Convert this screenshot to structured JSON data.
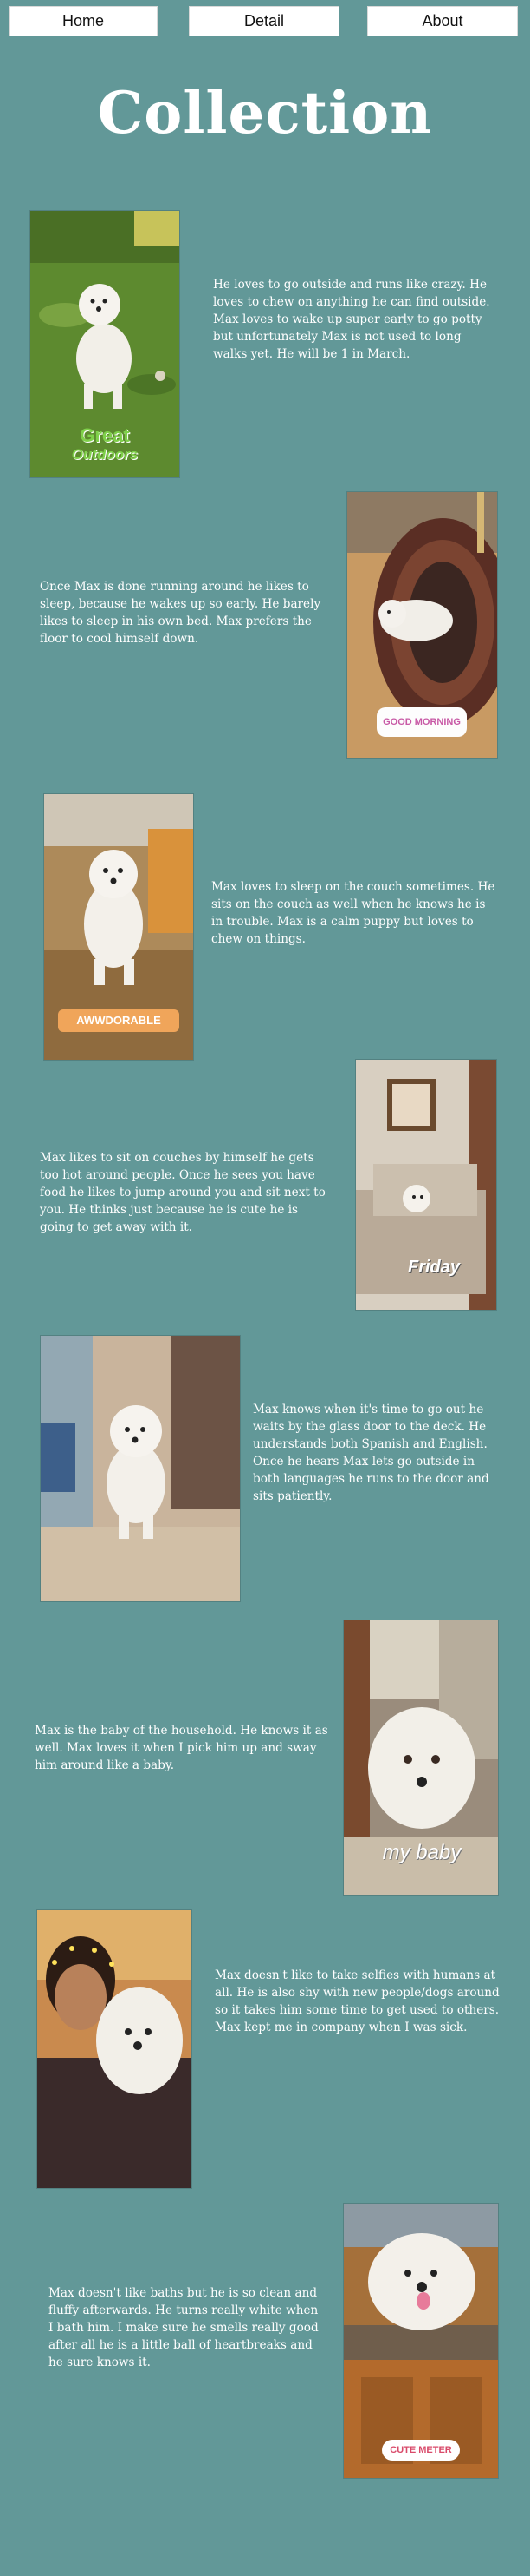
{
  "nav": {
    "home": "Home",
    "detail": "Detail",
    "about": "About"
  },
  "page_title": "Collection",
  "entries": [
    {
      "caption": "He loves to go outside and runs like crazy. He loves to chew on anything he can find outside. Max loves to wake up super early to go potty but unfortunately Max is not used to long walks yet. He will be 1 in March.",
      "sticker_line1": "Great",
      "sticker_line2": "Outdoors"
    },
    {
      "caption": "Once Max is done running around he likes to sleep, because he wakes up so early. He barely likes to sleep in his own bed. Max prefers the floor to cool himself down.",
      "sticker_line1": "GOOD MORNING"
    },
    {
      "caption": "Max loves to sleep on the couch sometimes. He sits on the couch as well when he knows he is in trouble. Max is a calm puppy but loves to chew on things.",
      "sticker_line1": "AWWDORABLE"
    },
    {
      "caption": "Max likes to sit on couches  by himself he gets too hot around people. Once he sees you have food he likes to jump around you and sit next to you. He thinks just because he is cute he is going to get away with it.",
      "sticker_line1": "Friday"
    },
    {
      "caption": "Max knows when it's time to go out he waits by the glass door to the deck. He understands both Spanish and English. Once he hears Max lets go outside in both languages he runs to the door and sits patiently."
    },
    {
      "caption": "Max is the baby of the household. He knows it as well. Max loves it when I pick him up and sway him around like a baby.",
      "sticker_line1": "my baby"
    },
    {
      "caption": "Max doesn't like to take selfies with humans at all. He is also shy with new people/dogs around so it takes him some time to get used to others. Max kept me in company when I was sick."
    },
    {
      "caption": "Max doesn't like baths but he is so clean and fluffy afterwards. He turns really white when I bath him. I make sure he smells really good after all he is a little ball of heartbreaks and he sure knows it.",
      "sticker_line1": "CUTE METER"
    }
  ],
  "colors": {
    "background": "#629898",
    "nav_button": "#ffffff",
    "text": "#ffffff"
  }
}
